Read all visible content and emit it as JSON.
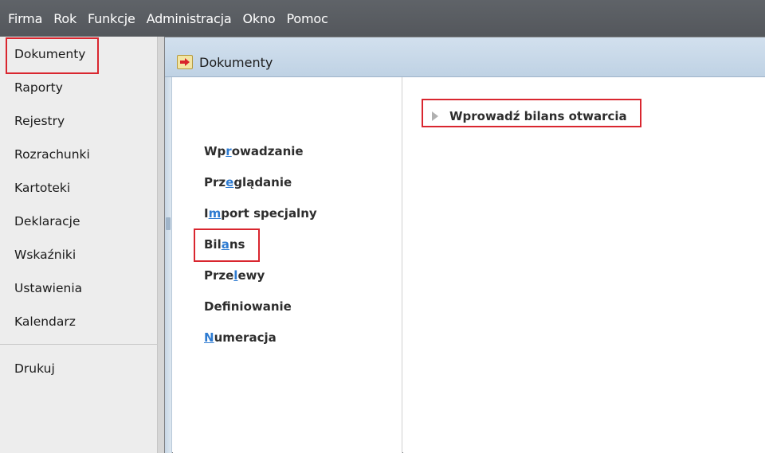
{
  "menubar": {
    "items": [
      "Firma",
      "Rok",
      "Funkcje",
      "Administracja",
      "Okno",
      "Pomoc"
    ]
  },
  "sidebar": {
    "items": [
      "Dokumenty",
      "Raporty",
      "Rejestry",
      "Rozrachunki",
      "Kartoteki",
      "Deklaracje",
      "Wskaźniki",
      "Ustawienia",
      "Kalendarz"
    ],
    "bottom_items": [
      "Drukuj"
    ],
    "selected": "Dokumenty"
  },
  "window": {
    "title": "Dokumenty",
    "icon": "document-arrow-icon"
  },
  "list": {
    "items": [
      {
        "pre": "Wp",
        "acc": "r",
        "post": "owadzanie"
      },
      {
        "pre": "Prz",
        "acc": "e",
        "post": "glądanie"
      },
      {
        "pre": "I",
        "acc": "m",
        "post": "port specjalny"
      },
      {
        "pre": "Bil",
        "acc": "a",
        "post": "ns"
      },
      {
        "pre": "Prze",
        "acc": "l",
        "post": "ewy"
      },
      {
        "pre": "Def",
        "acc": "i",
        "post": "niowanie"
      },
      {
        "pre": "",
        "acc": "N",
        "post": "umeracja"
      }
    ],
    "selected": "Bilans"
  },
  "content": {
    "action_label": "Wprowadź bilans otwarcia",
    "action_icon": "triangle-right-icon"
  },
  "colors": {
    "menubar": "#5a5d62",
    "highlight_border": "#d9262f",
    "accelerator": "#2e7bd1",
    "title_bar": "#c8d9ea"
  }
}
